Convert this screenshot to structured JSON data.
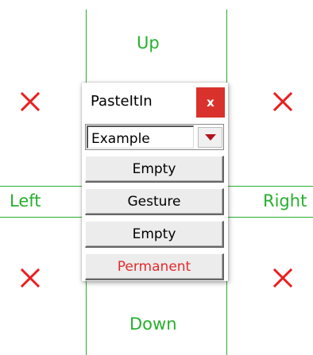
{
  "labels": {
    "up": "Up",
    "down": "Down",
    "left": "Left",
    "right": "Right"
  },
  "window": {
    "title": "PasteItIn",
    "close_label": "x"
  },
  "dropdown": {
    "selected": "Example"
  },
  "buttons": [
    {
      "label": "Empty"
    },
    {
      "label": "Gesture"
    },
    {
      "label": "Empty"
    },
    {
      "label": "Permanent"
    }
  ],
  "colors": {
    "guide_green": "#27b02c",
    "x_red": "#e8201f",
    "close_red": "#d9312c",
    "permanent_red": "#e32b2b"
  },
  "icons": {
    "corner_marks": "x-mark-icon",
    "close": "close-icon",
    "dropdown": "dropdown-arrow-icon"
  }
}
